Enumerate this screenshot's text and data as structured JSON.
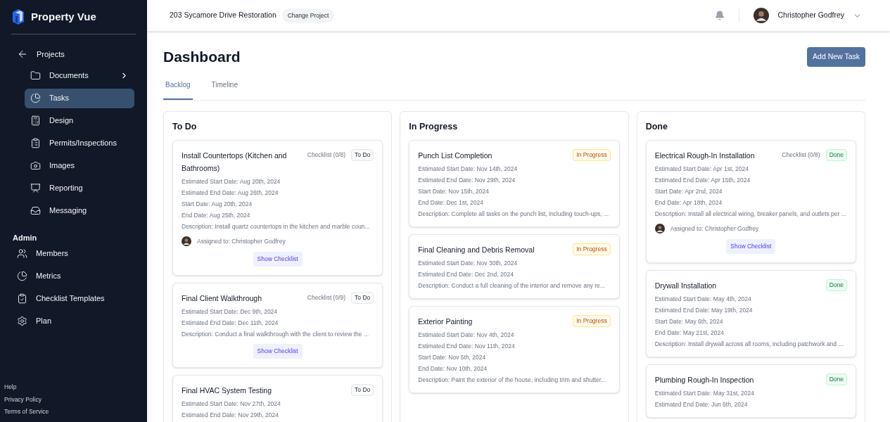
{
  "brand": "Property Vue",
  "sidebar": {
    "back": "Projects",
    "items": [
      {
        "label": "Documents",
        "selected": false,
        "submenu": true
      },
      {
        "label": "Tasks",
        "selected": true,
        "submenu": false
      },
      {
        "label": "Design",
        "selected": false,
        "submenu": false
      },
      {
        "label": "Permits/Inspections",
        "selected": false,
        "submenu": false
      },
      {
        "label": "Images",
        "selected": false,
        "submenu": false
      },
      {
        "label": "Reporting",
        "selected": false,
        "submenu": false
      },
      {
        "label": "Messaging",
        "selected": false,
        "submenu": false
      }
    ],
    "admin_heading": "Admin",
    "admin_items": [
      {
        "label": "Members"
      },
      {
        "label": "Metrics"
      },
      {
        "label": "Checklist Templates"
      },
      {
        "label": "Plan"
      }
    ],
    "footer_links": [
      "Help",
      "Privacy Policy",
      "Terms of Service"
    ]
  },
  "header": {
    "project": "203 Sycamore Drive Restoration",
    "change_project": "Change Project",
    "user": "Christopher Godfrey"
  },
  "page_title": "Dashboard",
  "add_button": "Add New Task",
  "tabs": [
    {
      "label": "Backlog",
      "selected": true
    },
    {
      "label": "Timeline",
      "selected": false
    }
  ],
  "columns": [
    {
      "title": "To Do",
      "tasks": [
        {
          "title": "Install Countertops (Kitchen and Bathrooms)",
          "checklist": "Checklist (0/8)",
          "status": {
            "label": "To Do",
            "kind": "todo"
          },
          "lines": [
            "Estimated Start Date: Aug 20th, 2024",
            "Estimated End Date: Aug 26th, 2024",
            "Start Date: Aug 20th, 2024",
            "End Date: Aug 25th, 2024",
            "Description: Install quartz countertops in the kitchen and marble coun..."
          ],
          "assignee": "Assigned to: Christopher Godfrey",
          "show_checklist": "Show Checklist"
        },
        {
          "title": "Final Client Walkthrough",
          "checklist": "Checklist (0/9)",
          "status": {
            "label": "To Do",
            "kind": "todo"
          },
          "lines": [
            "Estimated Start Date: Dec 9th, 2024",
            "Estimated End Date: Dec 11th, 2024",
            "Description: Conduct a final walkthrough with the client to review the ..."
          ],
          "show_checklist": "Show Checklist"
        },
        {
          "title": "Final HVAC System Testing",
          "status": {
            "label": "To Do",
            "kind": "todo"
          },
          "lines": [
            "Estimated Start Date: Nov 27th, 2024",
            "Estimated End Date: Nov 29th, 2024"
          ]
        }
      ]
    },
    {
      "title": "In Progress",
      "tasks": [
        {
          "title": "Punch List Completion",
          "status": {
            "label": "In Progress",
            "kind": "in_progress"
          },
          "lines": [
            "Estimated Start Date: Nov 14th, 2024",
            "Estimated End Date: Nov 29th, 2024",
            "Start Date: Nov 15th, 2024",
            "End Date: Dec 1st, 2024",
            "Description: Complete all tasks on the punch list, including touch-ups, ..."
          ]
        },
        {
          "title": "Final Cleaning and Debris Removal",
          "status": {
            "label": "In Progress",
            "kind": "in_progress"
          },
          "lines": [
            "Estimated Start Date: Nov 30th, 2024",
            "Estimated End Date: Dec 2nd, 2024",
            "Description: Conduct a full cleaning of the interior and remove any re..."
          ]
        },
        {
          "title": "Exterior Painting",
          "status": {
            "label": "In Progress",
            "kind": "in_progress"
          },
          "lines": [
            "Estimated Start Date: Nov 4th, 2024",
            "Estimated End Date: Nov 11th, 2024",
            "Start Date: Nov 5th, 2024",
            "End Date: Nov 10th, 2024",
            "Description: Paint the exterior of the house, including trim and shutter..."
          ]
        }
      ]
    },
    {
      "title": "Done",
      "tasks": [
        {
          "title": "Electrical Rough-In Installation",
          "checklist": "Checklist (0/8)",
          "status": {
            "label": "Done",
            "kind": "done"
          },
          "lines": [
            "Estimated Start Date: Apr 1st, 2024",
            "Estimated End Date: Apr 15th, 2024",
            "Start Date: Apr 2nd, 2024",
            "End Date: Apr 18th, 2024",
            "Description: Install all electrical wiring, breaker panels, and outlets per ..."
          ],
          "assignee": "Assigned to: Christopher Godfrey",
          "show_checklist": "Show Checklist"
        },
        {
          "title": "Drywall Installation",
          "status": {
            "label": "Done",
            "kind": "done"
          },
          "lines": [
            "Estimated Start Date: May 4th, 2024",
            "Estimated End Date: May 19th, 2024",
            "Start Date: May 6th, 2024",
            "End Date: May 21st, 2024",
            "Description: Install drywall across all rooms, including patchwork and ..."
          ]
        },
        {
          "title": "Plumbing Rough-In Inspection",
          "status": {
            "label": "Done",
            "kind": "done"
          },
          "lines": [
            "Estimated Start Date: May 31st, 2024",
            "Estimated End Date: Jun 6th, 2024"
          ]
        }
      ]
    }
  ]
}
